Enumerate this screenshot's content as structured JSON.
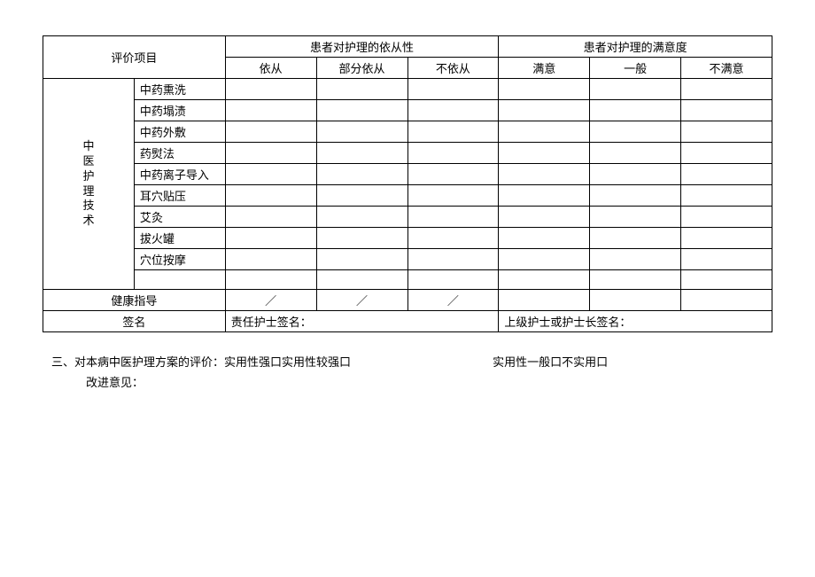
{
  "headers": {
    "eval_item": "评价项目",
    "compliance_group": "患者对护理的依从性",
    "satisfaction_group": "患者对护理的满意度",
    "compliance_cols": [
      "依从",
      "部分依从",
      "不依从"
    ],
    "satisfaction_cols": [
      "满意",
      "一般",
      "不满意"
    ]
  },
  "category_label": "中医护理技术",
  "techniques": [
    "中药熏洗",
    "中药塌渍",
    "中药外敷",
    "药熨法",
    "中药离子导入",
    "耳穴贴压",
    "艾灸",
    "拔火罐",
    "穴位按摩",
    ""
  ],
  "health_guidance_row": {
    "label": "健康指导",
    "cells": [
      "／",
      "／",
      "／",
      "",
      "",
      ""
    ]
  },
  "signature_row": {
    "label": "签名",
    "responsible_label": "责任护士签名：",
    "senior_label": "上级护士或护士长签名："
  },
  "footer": {
    "section_num": "三、",
    "eval_prefix": "对本病中医护理方案的评价：",
    "opt1": "实用性强口",
    "opt2": "实用性较强口",
    "opt3": "实用性一般口",
    "opt4": "不实用口",
    "improve_label": "改进意见："
  }
}
